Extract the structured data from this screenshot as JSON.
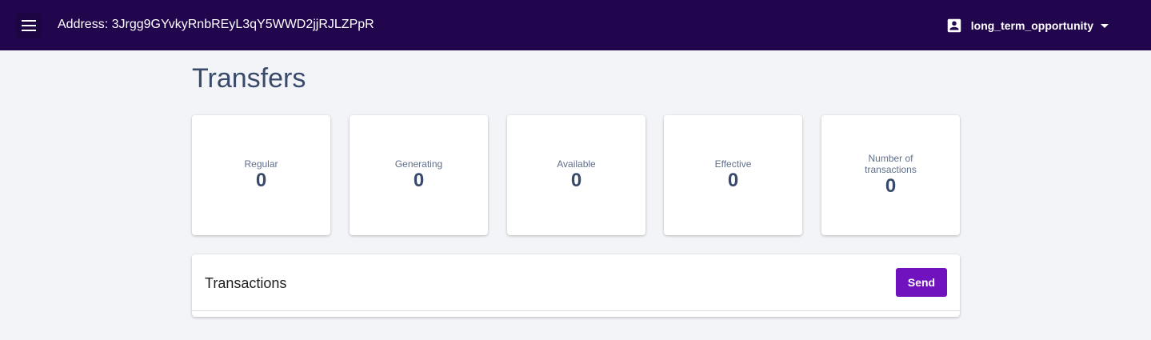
{
  "header": {
    "address_label": "Address: 3Jrgg9GYvkyRnbREyL3qY5WWD2jjRJLZPpR",
    "account_name": "long_term_opportunity",
    "menu_icon": "hamburger-menu-icon",
    "account_icon": "account-box-icon",
    "background_color": "#21064d"
  },
  "page": {
    "title": "Transfers"
  },
  "stats": [
    {
      "label": "Regular",
      "value": "0"
    },
    {
      "label": "Generating",
      "value": "0"
    },
    {
      "label": "Available",
      "value": "0"
    },
    {
      "label": "Effective",
      "value": "0"
    },
    {
      "label": "Number of transactions",
      "value": "0"
    }
  ],
  "transactions": {
    "title": "Transactions",
    "send_label": "Send",
    "send_color": "#7012be"
  }
}
